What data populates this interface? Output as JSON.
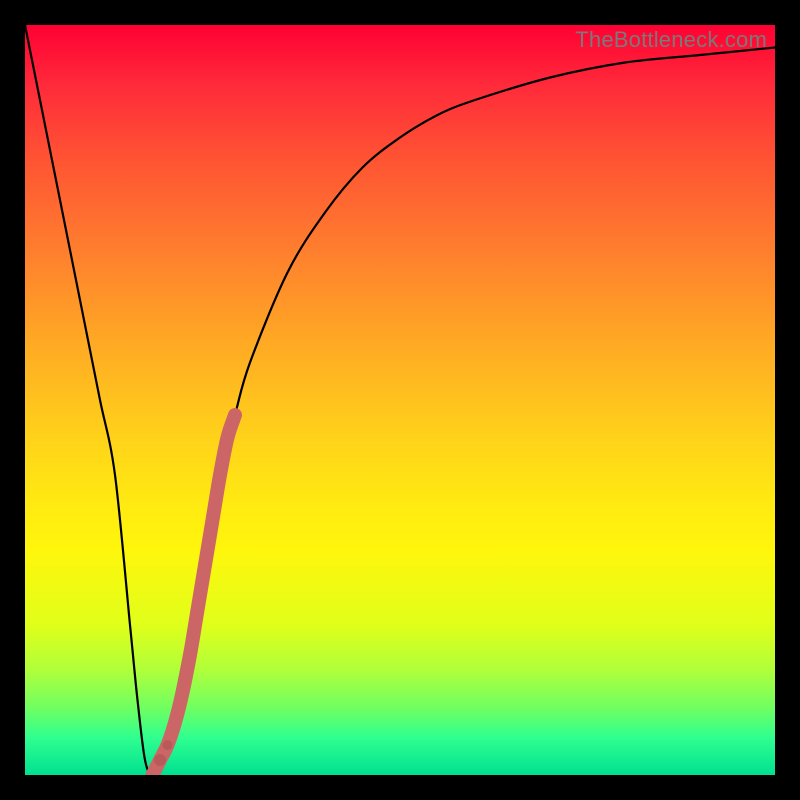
{
  "watermark": "TheBottleneck.com",
  "chart_data": {
    "type": "line",
    "title": "",
    "xlabel": "",
    "ylabel": "",
    "xlim": [
      0,
      100
    ],
    "ylim": [
      0,
      100
    ],
    "grid": false,
    "series": [
      {
        "name": "bottleneck-curve",
        "x": [
          0,
          2,
          4,
          6,
          8,
          10,
          12,
          14,
          15,
          16,
          17,
          18,
          20,
          22,
          24,
          26,
          28,
          30,
          35,
          40,
          45,
          50,
          55,
          60,
          70,
          80,
          90,
          100
        ],
        "y": [
          100,
          90,
          80,
          70,
          60,
          50,
          40,
          20,
          10,
          2,
          0,
          2,
          10,
          20,
          30,
          40,
          48,
          55,
          67,
          75,
          81,
          85,
          88,
          90,
          93,
          95,
          96,
          97
        ]
      },
      {
        "name": "highlight-segment",
        "x": [
          17,
          18,
          19,
          20,
          21,
          22,
          23,
          24,
          25,
          26,
          27,
          28
        ],
        "y": [
          0,
          2,
          4,
          7,
          11,
          16,
          22,
          28,
          34,
          40,
          45,
          48
        ]
      }
    ],
    "annotations": []
  },
  "colors": {
    "curve": "#000000",
    "highlight": "#cc6666",
    "highlight_dot": "#b85a5a"
  }
}
